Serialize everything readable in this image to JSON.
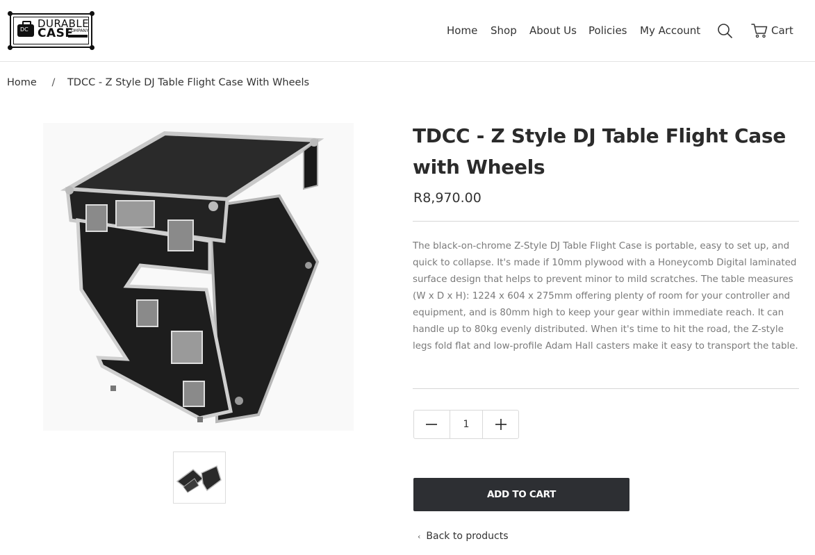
{
  "brand": {
    "logo_line1": "DURABLE",
    "logo_line2": "CASE",
    "logo_sub": "COMPANY"
  },
  "nav": {
    "items": [
      {
        "label": "Home"
      },
      {
        "label": "Shop"
      },
      {
        "label": "About Us"
      },
      {
        "label": "Policies"
      },
      {
        "label": "My Account"
      }
    ],
    "search_icon": "search-icon",
    "cart_icon": "cart-icon",
    "cart_label": "Cart"
  },
  "breadcrumb": {
    "home": "Home",
    "separator": "/",
    "current": "TDCC - Z Style DJ Table Flight Case With Wheels"
  },
  "product": {
    "title": "TDCC - Z Style DJ Table Flight Case with Wheels",
    "price": "R8,970.00",
    "description": "The black-on-chrome Z-Style DJ Table Flight Case is portable, easy to set up, and quick to collapse. It's made if 10mm plywood with a Honeycomb Digital laminated surface design that helps to prevent minor to mild scratches. The table measures (W x D x H): 1224 x 604 x 275mm  offering plenty of room for your controller and equipment, and is 80mm high to keep your gear within immediate reach. It can handle up to 80kg evenly distributed. When it's time to hit the road, the Z-style legs fold flat and low-profile Adam Hall casters make it easy to transport the table.",
    "quantity": "1",
    "add_to_cart_label": "ADD TO CART",
    "back_label": "Back to products"
  },
  "colors": {
    "button_bg": "#2d2f33",
    "text": "#333333",
    "description_text": "#7a7a7a",
    "divider": "#d6d6d6"
  }
}
